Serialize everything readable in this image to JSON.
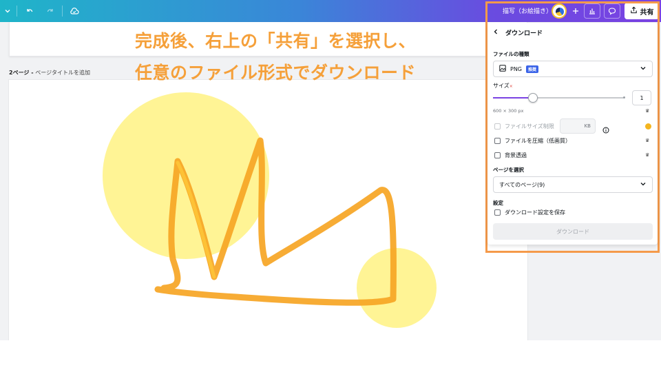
{
  "topbar": {
    "doc_title": "描写（お絵描き）機能",
    "share_label": "共有",
    "icons": [
      "chevron-down-icon",
      "undo-icon",
      "redo-icon",
      "cloud-sync-icon",
      "plus-icon",
      "chart-icon",
      "comment-icon",
      "share-upload-icon"
    ]
  },
  "canvas": {
    "page_number_label": "2ページ - ",
    "page_title_placeholder": "ページタイトルを追加"
  },
  "caption": {
    "line1": "完成後、右上の「共有」を選択し、",
    "line2": "任意のファイル形式でダウンロード"
  },
  "download_panel": {
    "title": "ダウンロード",
    "file_type_label": "ファイルの種類",
    "file_type_value": "PNG",
    "file_type_badge": "推奨",
    "size_label": "サイズ",
    "size_marker": "×",
    "size_value": "1",
    "size_min": 0.125,
    "size_max": 3,
    "size_dimensions": "600 × 300 px",
    "file_size_limit_label": "ファイルサイズ制限",
    "kb_unit": "KB",
    "compress_label": "ファイルを圧縮（低画質）",
    "transparent_label": "背景透過",
    "page_select_label": "ページを選択",
    "page_select_value": "すべてのページ(9)",
    "settings_label": "設定",
    "save_settings_label": "ダウンロード設定を保存",
    "download_button": "ダウンロード"
  },
  "colors": {
    "accent_orange": "#f59a4a",
    "caption_orange": "#f5a03a",
    "brand_purple": "#7a42e3",
    "drawing_yellow": "#fff38a",
    "drawing_stroke": "#f6a524"
  }
}
